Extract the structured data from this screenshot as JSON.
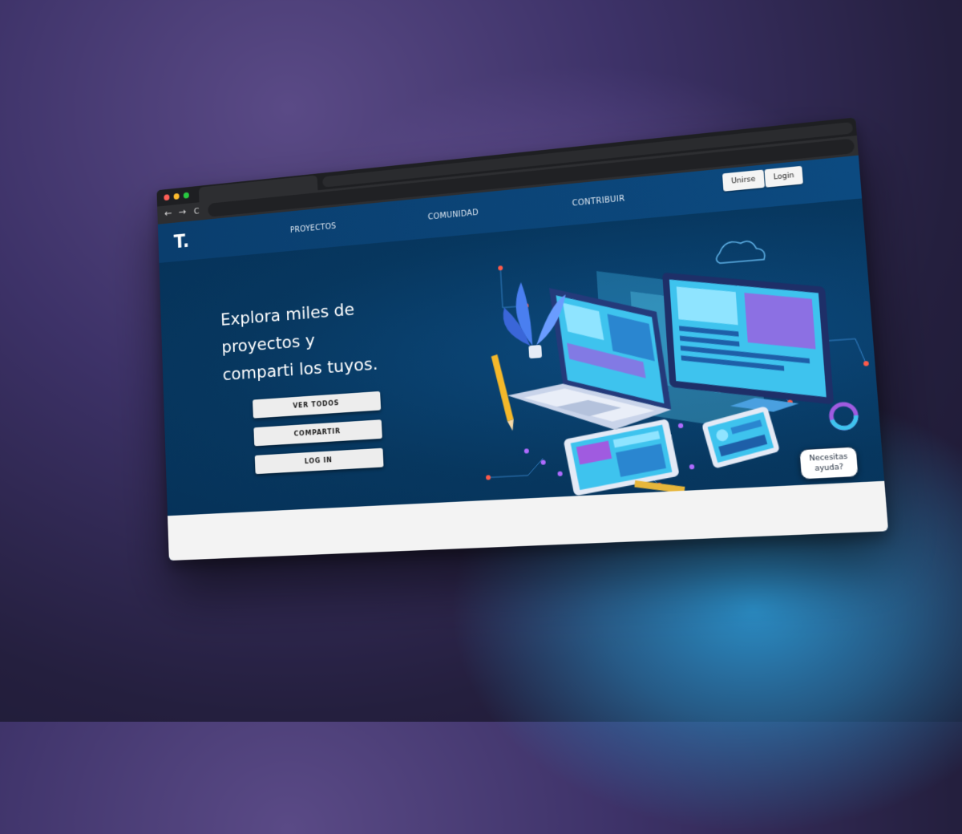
{
  "colors": {
    "chrome": "#2d2e31",
    "page_bg": "#07375f",
    "header_bg": "#0c4a80",
    "button_bg": "#ededed",
    "dot_red": "#ff5f57",
    "dot_yellow": "#febc2e",
    "dot_green": "#28c840"
  },
  "browser": {
    "back_icon": "←",
    "forward_icon": "→",
    "reload_icon": "C"
  },
  "site": {
    "logo": "T.",
    "nav": [
      "PROYECTOS",
      "COMUNIDAD",
      "CONTRIBUIR"
    ],
    "join_label": "Unirse",
    "login_label": "Login"
  },
  "hero": {
    "headline_lines": [
      "Explora miles de",
      "proyectos y",
      "comparti los tuyos."
    ],
    "buttons": [
      "VER TODOS",
      "COMPARTIR",
      "LOG IN"
    ]
  },
  "help": {
    "line1": "Necesitas",
    "line2": "ayuda?"
  }
}
